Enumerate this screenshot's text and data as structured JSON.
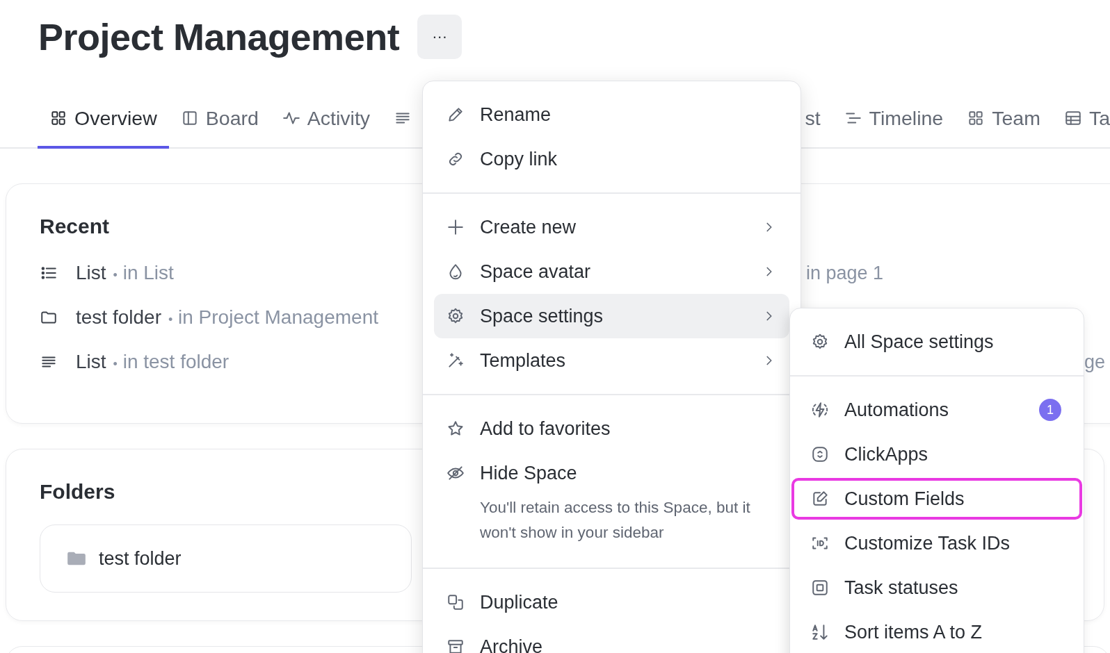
{
  "page": {
    "title": "Project Management",
    "more_button": "···"
  },
  "tabs": [
    {
      "label": "Overview",
      "selected": true
    },
    {
      "label": "Board",
      "selected": false
    },
    {
      "label": "Activity",
      "selected": false
    },
    {
      "selected": false
    },
    {
      "label": "st",
      "selected": false
    },
    {
      "label": "Timeline",
      "selected": false
    },
    {
      "label": "Team",
      "selected": false
    },
    {
      "label": "Ta",
      "selected": false
    }
  ],
  "recent": {
    "title": "Recent",
    "items": [
      {
        "name": "List",
        "separator": "•",
        "location": "in List"
      },
      {
        "name": "test folder",
        "separator": "•",
        "location": "in Project Management"
      },
      {
        "name": "List",
        "separator": "•",
        "location": "in test folder"
      }
    ],
    "column_2": [
      "in page 1",
      "ge"
    ]
  },
  "folders": {
    "title": "Folders",
    "items": [
      {
        "name": "test folder"
      }
    ]
  },
  "menu": {
    "sections": [
      [
        {
          "label": "Rename",
          "has_submenu": false,
          "selected": false
        },
        {
          "label": "Copy link",
          "has_submenu": false,
          "selected": false
        }
      ],
      [
        {
          "label": "Create new",
          "has_submenu": true,
          "selected": false
        },
        {
          "label": "Space avatar",
          "has_submenu": true,
          "selected": false
        },
        {
          "label": "Space settings",
          "has_submenu": true,
          "selected": true
        },
        {
          "label": "Templates",
          "has_submenu": true,
          "selected": false
        }
      ],
      [
        {
          "label": "Add to favorites",
          "has_submenu": false,
          "selected": false
        },
        {
          "label": "Hide Space",
          "has_submenu": false,
          "selected": false,
          "description": "You'll retain access to this Space, but it won't show in your sidebar"
        }
      ],
      [
        {
          "label": "Duplicate",
          "has_submenu": false,
          "selected": false
        },
        {
          "label": "Archive",
          "has_submenu": false,
          "selected": false
        }
      ]
    ]
  },
  "submenu": {
    "sections": [
      [
        {
          "label": "All Space settings",
          "highlighted": false
        }
      ],
      [
        {
          "label": "Automations",
          "badge": "1",
          "highlighted": false
        },
        {
          "label": "ClickApps",
          "highlighted": false
        },
        {
          "label": "Custom Fields",
          "highlighted": true
        },
        {
          "label": "Customize Task IDs",
          "highlighted": false
        },
        {
          "label": "Task statuses",
          "highlighted": false
        },
        {
          "label": "Sort items A to Z",
          "highlighted": false
        }
      ]
    ]
  }
}
